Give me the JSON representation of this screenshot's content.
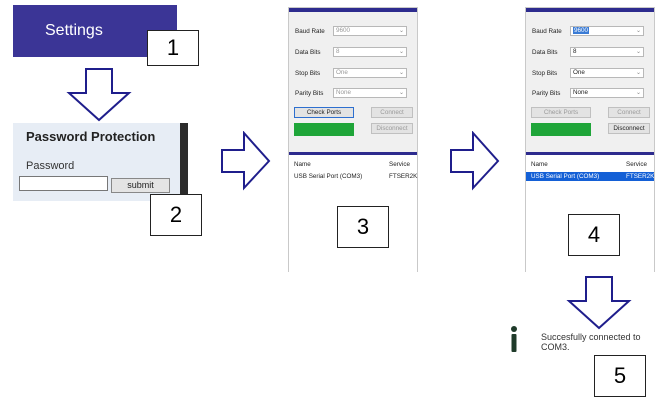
{
  "steps": [
    "1",
    "2",
    "3",
    "4",
    "5"
  ],
  "settings": {
    "label": "Settings"
  },
  "password": {
    "title": "Password Protection",
    "label": "Password",
    "value": "",
    "submit": "submit"
  },
  "panel3": {
    "baud_label": "Baud Rate",
    "baud_value": "9600",
    "data_label": "Data Bits",
    "data_value": "8",
    "stop_label": "Stop Bits",
    "stop_value": "One",
    "parity_label": "Parity Bits",
    "parity_value": "None",
    "check_ports": "Check Ports",
    "connect": "Connect",
    "disconnect": "Disconnect",
    "col_name": "Name",
    "col_service": "Service",
    "row_name": "USB Serial Port (COM3)",
    "row_service": "FTSER2K"
  },
  "panel4": {
    "baud_label": "Baud Rate",
    "baud_value": "9600",
    "data_label": "Data Bits",
    "data_value": "8",
    "stop_label": "Stop Bits",
    "stop_value": "One",
    "parity_label": "Parity Bits",
    "parity_value": "None",
    "check_ports": "Check Ports",
    "connect": "Connect",
    "disconnect": "Disconnect",
    "col_name": "Name",
    "col_service": "Service",
    "row_name": "USB Serial Port (COM3)",
    "row_service": "FTSER2K"
  },
  "notification": {
    "message": "Succesfully connected to COM3."
  },
  "colors": {
    "accent": "#3b3596",
    "arrow": "#1f1e8c",
    "status_ok": "#1fa539",
    "selection": "#1460d6"
  }
}
